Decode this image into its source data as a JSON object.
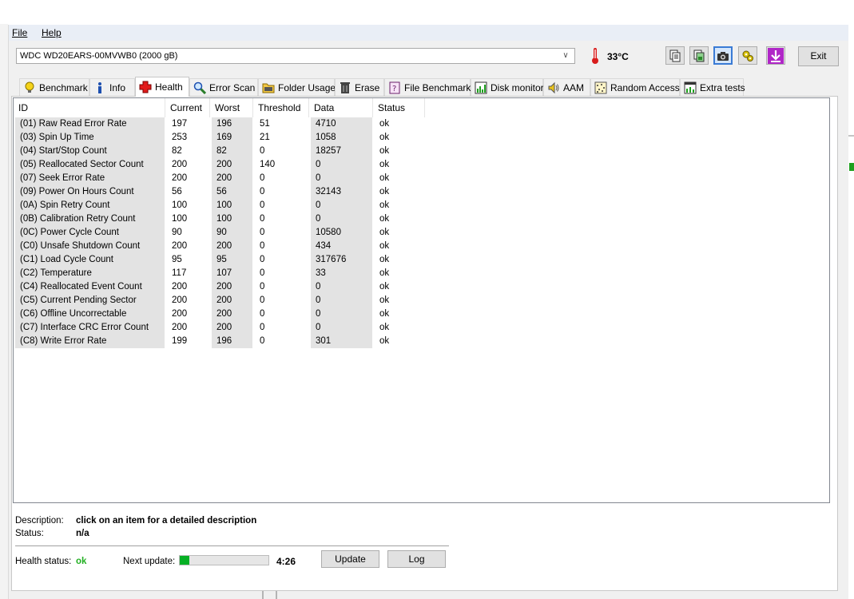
{
  "menu": {
    "file": "File",
    "help": "Help"
  },
  "drive": {
    "selected": "WDC WD20EARS-00MVWB0 (2000 gB)"
  },
  "temperature": "33°C",
  "toolbar": {
    "exit_label": "Exit"
  },
  "tabs": [
    {
      "label": "Benchmark",
      "icon": "bulb-icon"
    },
    {
      "label": "Info",
      "icon": "info-icon"
    },
    {
      "label": "Health",
      "icon": "red-cross-icon"
    },
    {
      "label": "Error Scan",
      "icon": "magnifier-icon"
    },
    {
      "label": "Folder Usage",
      "icon": "folder-icon"
    },
    {
      "label": "Erase",
      "icon": "trash-icon"
    },
    {
      "label": "File Benchmark",
      "icon": "file-benchmark-icon"
    },
    {
      "label": "Disk monitor",
      "icon": "disk-monitor-icon"
    },
    {
      "label": "AAM",
      "icon": "speaker-icon"
    },
    {
      "label": "Random Access",
      "icon": "random-access-icon"
    },
    {
      "label": "Extra tests",
      "icon": "extra-tests-icon"
    }
  ],
  "active_tab": "Health",
  "table": {
    "headers": [
      "ID",
      "Current",
      "Worst",
      "Threshold",
      "Data",
      "Status"
    ],
    "rows": [
      [
        "(01) Raw Read Error Rate",
        "197",
        "196",
        "51",
        "4710",
        "ok"
      ],
      [
        "(03) Spin Up Time",
        "253",
        "169",
        "21",
        "1058",
        "ok"
      ],
      [
        "(04) Start/Stop Count",
        "82",
        "82",
        "0",
        "18257",
        "ok"
      ],
      [
        "(05) Reallocated Sector Count",
        "200",
        "200",
        "140",
        "0",
        "ok"
      ],
      [
        "(07) Seek Error Rate",
        "200",
        "200",
        "0",
        "0",
        "ok"
      ],
      [
        "(09) Power On Hours Count",
        "56",
        "56",
        "0",
        "32143",
        "ok"
      ],
      [
        "(0A) Spin Retry Count",
        "100",
        "100",
        "0",
        "0",
        "ok"
      ],
      [
        "(0B) Calibration Retry Count",
        "100",
        "100",
        "0",
        "0",
        "ok"
      ],
      [
        "(0C) Power Cycle Count",
        "90",
        "90",
        "0",
        "10580",
        "ok"
      ],
      [
        "(C0) Unsafe Shutdown Count",
        "200",
        "200",
        "0",
        "434",
        "ok"
      ],
      [
        "(C1) Load Cycle Count",
        "95",
        "95",
        "0",
        "317676",
        "ok"
      ],
      [
        "(C2) Temperature",
        "117",
        "107",
        "0",
        "33",
        "ok"
      ],
      [
        "(C4) Reallocated Event Count",
        "200",
        "200",
        "0",
        "0",
        "ok"
      ],
      [
        "(C5) Current Pending Sector",
        "200",
        "200",
        "0",
        "0",
        "ok"
      ],
      [
        "(C6) Offline Uncorrectable",
        "200",
        "200",
        "0",
        "0",
        "ok"
      ],
      [
        "(C7) Interface CRC Error Count",
        "200",
        "200",
        "0",
        "0",
        "ok"
      ],
      [
        "(C8) Write Error Rate",
        "199",
        "196",
        "0",
        "301",
        "ok"
      ]
    ]
  },
  "details": {
    "description_label": "Description:",
    "description_value": "click on an item for a detailed description",
    "status_label": "Status:",
    "status_value": "n/a"
  },
  "health": {
    "label": "Health status:",
    "value": "ok",
    "next_update_label": "Next update:",
    "countdown": "4:26",
    "progress_fraction": 0.11,
    "update_button": "Update",
    "log_button": "Log"
  },
  "colors": {
    "ok_green": "#22b022",
    "progress_green": "#06b025",
    "selection_blue": "#3a7bd5"
  }
}
